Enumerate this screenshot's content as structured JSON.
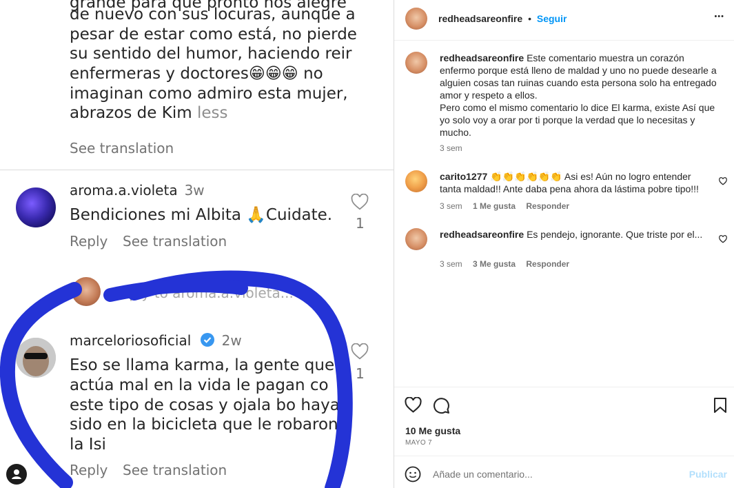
{
  "left": {
    "comment_top": {
      "lines": [
        "grande para que pronto nos alegre",
        "de nuevo con sus locuras, aunque a",
        "pesar de estar como está, no pierde",
        "su sentido del humor, haciendo reir",
        "enfermeras y doctores",
        "imaginan como admiro esta mujer,",
        "abrazos de Kim"
      ],
      "emoji_tail": "😁😁😁",
      "line5_tail": " no",
      "less": "less",
      "see_translation": "See translation"
    },
    "comment_aroma": {
      "username": "aroma.a.violeta",
      "age": "3w",
      "text": "Bendiciones mi Albita",
      "emoji": "🙏",
      "text_tail": "Cuidate.",
      "likes": "1",
      "reply": "Reply",
      "see_translation": "See translation"
    },
    "reply_field": {
      "placeholder": "Reply to aroma.a.violeta..."
    },
    "comment_marcelo": {
      "username": "marceloriosoficial",
      "age": "2w",
      "lines": [
        "Eso se llama karma, la gente que",
        "actúa mal en la vida le pagan co",
        "este tipo de cosas y ojala bo haya",
        "sido en la bicicleta que le robaron a",
        "la Isi"
      ],
      "likes": "1",
      "reply": "Reply",
      "see_translation": "See translation"
    }
  },
  "right": {
    "header": {
      "username": "redheadsareonfire",
      "dot": "•",
      "follow": "Seguir",
      "more": "•••"
    },
    "comments": [
      {
        "username": "redheadsareonfire",
        "text": "Este comentario muestra un corazón enfermo porque está lleno de maldad y uno no puede desearle a alguien cosas tan ruinas cuando esta persona solo ha entregado amor y respeto a ellos.",
        "text2": "Pero como el mismo comentario lo dice El karma, existe Así que yo solo voy a orar por ti porque la verdad que lo necesitas y mucho.",
        "time": "3 sem"
      },
      {
        "username": "carito1277",
        "emoji": "👏👏👏👏👏👏",
        "text": "Asi es! Aún no logro entender tanta maldad!! Ante daba pena ahora da lástima pobre tipo!!!",
        "time": "3 sem",
        "likes": "1 Me gusta",
        "reply": "Responder"
      },
      {
        "username": "redheadsareonfire",
        "text": "Es pendejo, ignorante. Que triste por el...",
        "time": "3 sem",
        "likes": "3 Me gusta",
        "reply": "Responder"
      }
    ],
    "likes_count": "10 Me gusta",
    "date": "MAYO 7",
    "add_comment": {
      "placeholder": "Añade un comentario...",
      "publish": "Publicar"
    }
  }
}
